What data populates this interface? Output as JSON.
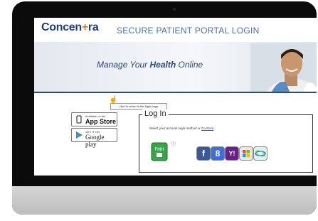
{
  "header": {
    "logo_text": "Concen",
    "logo_cross": "+",
    "logo_text_end": "ra",
    "portal_title": "SECURE PATIENT PORTAL LOGIN"
  },
  "banner": {
    "pre": "Manage Your ",
    "bold": "Health",
    "post": " Online"
  },
  "tooltip": "click to return to the login page",
  "app_store": {
    "small": "Available on the",
    "big": "App Store"
  },
  "google_play": {
    "small": "GET IT ON",
    "big": "Google play"
  },
  "login": {
    "title": "Log In",
    "instruction": "Select your account login method or ",
    "go_back": "Go Back",
    "instruction_end": ".",
    "fmh_label": "FMH",
    "info": "ⓘ"
  },
  "providers": [
    {
      "name": "facebook",
      "glyph": "f"
    },
    {
      "name": "google",
      "glyph": "8"
    },
    {
      "name": "yahoo",
      "glyph": "Y!"
    },
    {
      "name": "microsoft",
      "glyph": ""
    },
    {
      "name": "other",
      "glyph": ""
    }
  ],
  "colors": {
    "brand_blue": "#1f3d7a",
    "brand_orange": "#e07a1f",
    "link": "#1f4fbf"
  }
}
